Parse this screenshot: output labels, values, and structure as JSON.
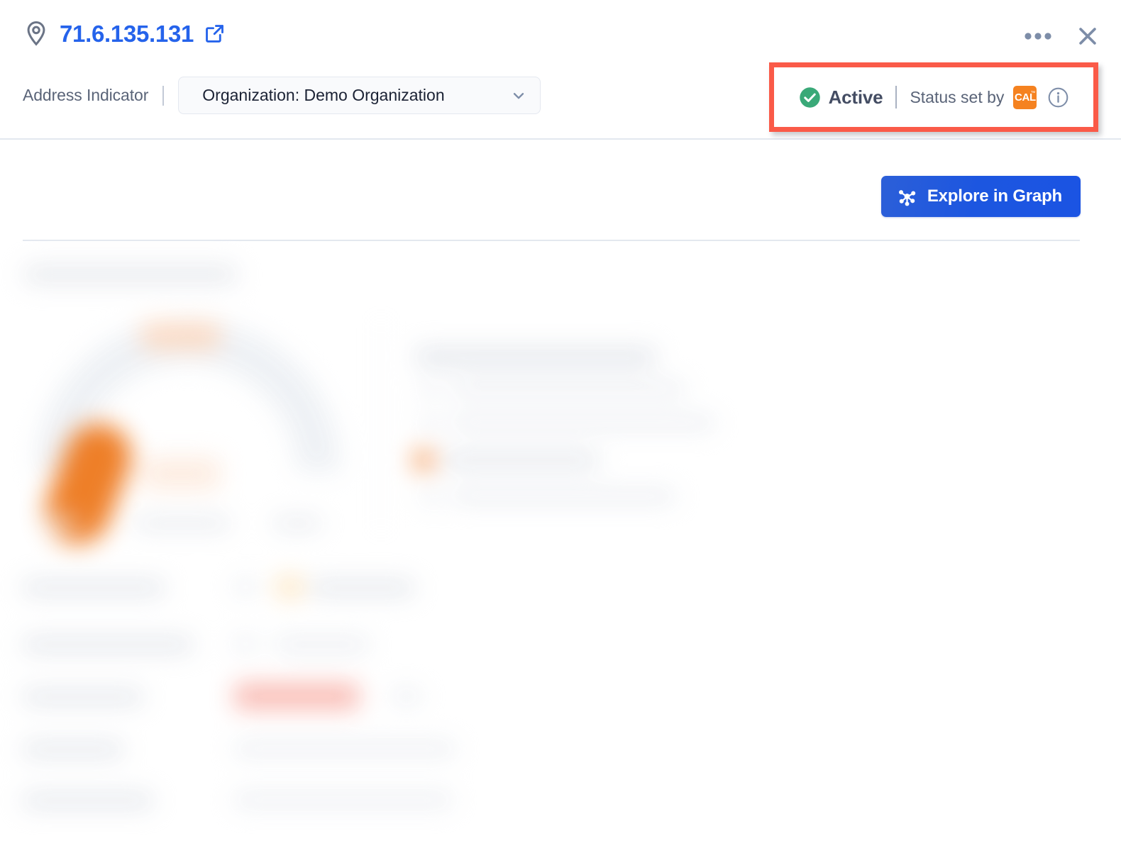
{
  "header": {
    "pin_icon": "location-pin-icon",
    "ip_address": "71.6.135.131",
    "external_link_icon": "external-link-icon",
    "address_indicator_label": "Address Indicator",
    "organization_select_value": "Organization: Demo Organization",
    "chevron_icon": "chevron-down-icon",
    "more_icon": "more-options-icon",
    "close_icon": "close-icon"
  },
  "status": {
    "check_icon": "check-circle-icon",
    "active_label": "Active",
    "set_by_label": "Status set by",
    "source_badge_text": "CAL",
    "source_badge_tm": "™",
    "info_icon": "info-icon",
    "highlight_color": "#fa5a48",
    "active_color": "#3aa978",
    "badge_color": "#f58220"
  },
  "actions": {
    "explore_label": "Explore in Graph",
    "explore_icon": "graph-nodes-icon",
    "explore_color": "#1c56e0"
  },
  "colors": {
    "link_blue": "#2563eb",
    "text_dark": "#1b2234",
    "text_muted": "#5a6478",
    "divider": "#e3e8ef",
    "accent_orange": "#ee7b22"
  },
  "body": {
    "state": "blurred",
    "note": "Content below the divider is rendered blurred/redacted in the screenshot",
    "chart_data": {
      "type": "gauge",
      "title": "",
      "value": null,
      "ranges": [],
      "accent_color": "#ee7b22",
      "track_color": "#eef1f5"
    }
  }
}
